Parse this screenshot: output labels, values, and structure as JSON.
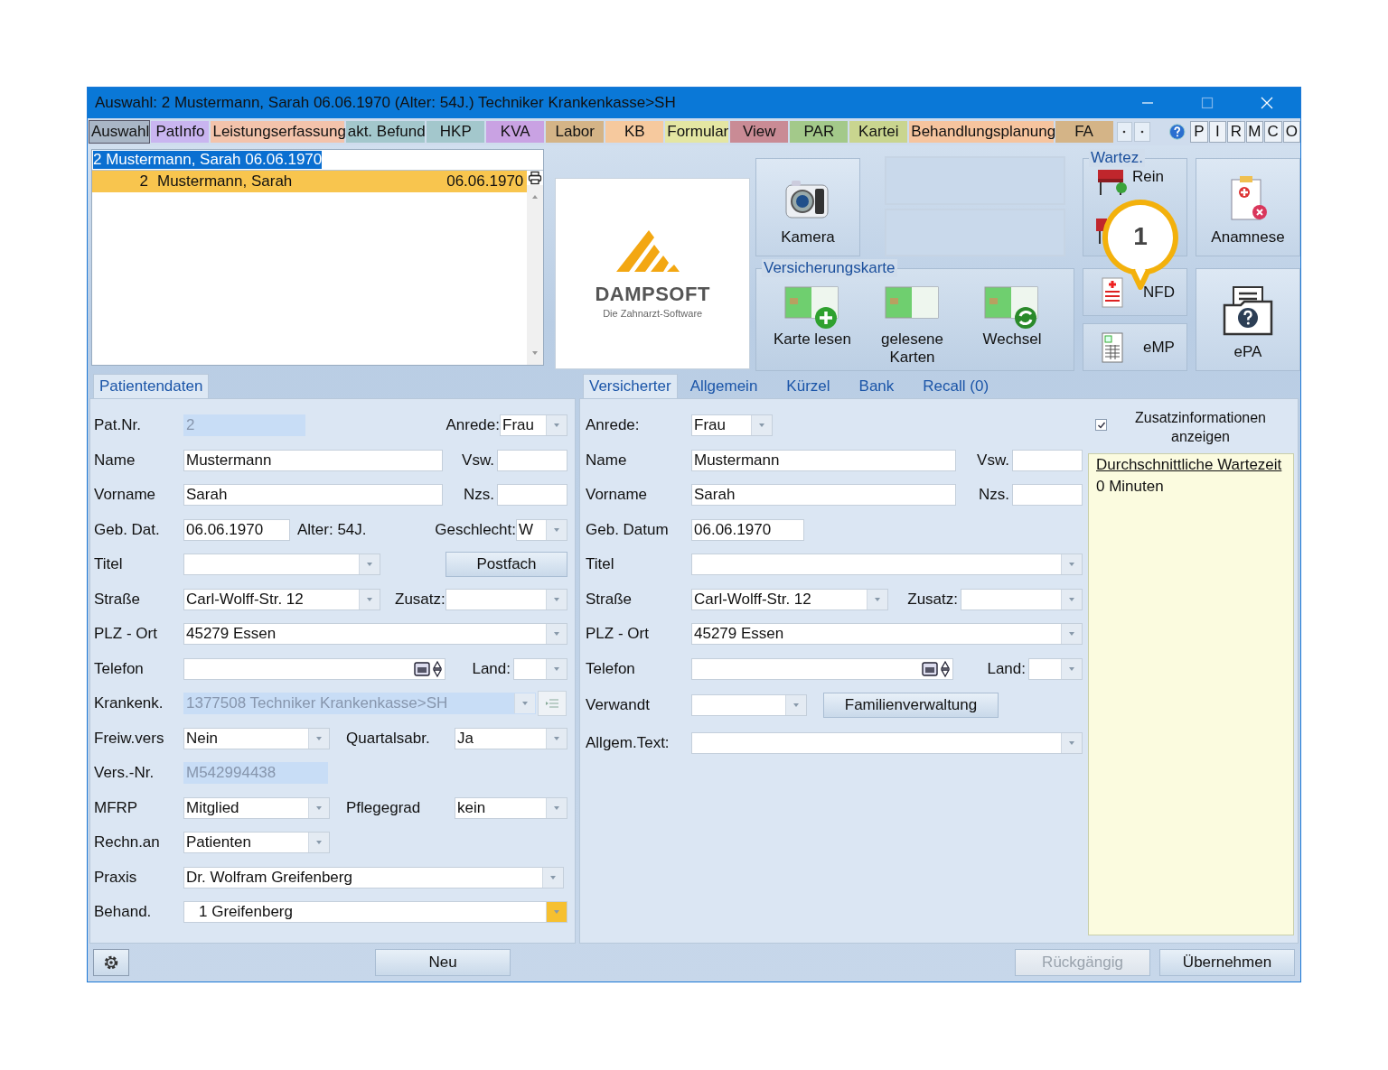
{
  "window": {
    "title": "Auswahl: 2  Mustermann, Sarah  06.06.1970 (Alter: 54J.)  Techniker Krankenkasse>SH"
  },
  "tabs": [
    {
      "label": "Auswahl",
      "color": "#a9b6c6",
      "selected": true
    },
    {
      "label": "PatInfo",
      "color": "#c9b5f0",
      "selected": false
    },
    {
      "label": "Leistungserfassung",
      "color": "#f3c3ab",
      "selected": false
    },
    {
      "label": "akt. Befund",
      "color": "#a3c7cc",
      "selected": false
    },
    {
      "label": "HKP",
      "color": "#a3c7cc",
      "selected": false
    },
    {
      "label": "KVA",
      "color": "#c9a2e3",
      "selected": false
    },
    {
      "label": "Labor",
      "color": "#d4b487",
      "selected": false
    },
    {
      "label": "KB",
      "color": "#f6c99e",
      "selected": false
    },
    {
      "label": "Formular",
      "color": "#e4e6a3",
      "selected": false
    },
    {
      "label": "View",
      "color": "#c98b95",
      "selected": false
    },
    {
      "label": "PAR",
      "color": "#a3c98a",
      "selected": false
    },
    {
      "label": "Kartei",
      "color": "#c9d58f",
      "selected": false
    },
    {
      "label": "Behandlungsplanung",
      "color": "#f6c49e",
      "selected": false
    },
    {
      "label": "FA",
      "color": "#d4b487",
      "selected": false
    }
  ],
  "quick_buttons": [
    "P",
    "I",
    "R",
    "M",
    "C",
    "O"
  ],
  "patient_search": {
    "value": "2 Mustermann, Sarah  06.06.1970"
  },
  "patient_list": [
    {
      "number": "2",
      "name": "Mustermann, Sarah",
      "birthdate": "06.06.1970",
      "selected": true
    }
  ],
  "logo": {
    "name": "DAMPSOFT",
    "tagline": "Die Zahnarzt-Software"
  },
  "toolbar": {
    "camera": "Kamera",
    "waiting_room_title": "Wartez.",
    "waiting_in": "Rein",
    "anamnesis": "Anamnese",
    "nfd": "NFD",
    "emp": "eMP",
    "epa": "ePA"
  },
  "insurance_card": {
    "title": "Versicherungskarte",
    "buttons": [
      {
        "label": "Karte lesen",
        "kind": "add"
      },
      {
        "label": "gelesene Karten",
        "kind": "plain"
      },
      {
        "label": "Wechsel",
        "kind": "swap"
      }
    ]
  },
  "callout": {
    "text": "1"
  },
  "patient_data": {
    "tab": "Patientendaten",
    "pat_nr": {
      "label": "Pat.Nr.",
      "value": "2",
      "disabled": true
    },
    "anrede": {
      "label": "Anrede:",
      "value": "Frau"
    },
    "name": {
      "label": "Name",
      "value": "Mustermann"
    },
    "vsw": {
      "label": "Vsw."
    },
    "vorname": {
      "label": "Vorname",
      "value": "Sarah"
    },
    "nzs": {
      "label": "Nzs."
    },
    "geb": {
      "label": "Geb. Dat.",
      "value": "06.06.1970"
    },
    "alter": "Alter: 54J.",
    "geschlecht": {
      "label": "Geschlecht:",
      "value": "W"
    },
    "titel": {
      "label": "Titel"
    },
    "postfach": "Postfach",
    "strasse": {
      "label": "Straße",
      "value": "Carl-Wolff-Str. 12"
    },
    "zusatz": {
      "label": "Zusatz:"
    },
    "plz_ort": {
      "label": "PLZ - Ort",
      "value": "45279 Essen"
    },
    "telefon": {
      "label": "Telefon"
    },
    "land": {
      "label": "Land:"
    },
    "krankenk": {
      "label": "Krankenk.",
      "value": "1377508 Techniker Krankenkasse>SH",
      "disabled": true
    },
    "freiw": {
      "label": "Freiw.vers",
      "value": "Nein"
    },
    "quartal": {
      "label": "Quartalsabr.",
      "value": "Ja"
    },
    "vers_nr": {
      "label": "Vers.-Nr.",
      "value": "M542994438",
      "disabled": true
    },
    "mfrp": {
      "label": "MFRP",
      "value": "Mitglied"
    },
    "pflegegrad": {
      "label": "Pflegegrad",
      "value": "kein"
    },
    "rechn": {
      "label": "Rechn.an",
      "value": "Patienten"
    },
    "praxis": {
      "label": "Praxis",
      "value": "Dr. Wolfram Greifenberg"
    },
    "behand": {
      "label": "Behand.",
      "value": "1 Greifenberg"
    }
  },
  "insured": {
    "tabs": [
      {
        "label": "Versicherter",
        "selected": true
      },
      {
        "label": "Allgemein",
        "selected": false
      },
      {
        "label": "Kürzel",
        "selected": false
      },
      {
        "label": "Bank",
        "selected": false
      },
      {
        "label": "Recall (0)",
        "selected": false
      }
    ],
    "anrede": {
      "label": "Anrede:",
      "value": "Frau"
    },
    "name": {
      "label": "Name",
      "value": "Mustermann"
    },
    "vsw": {
      "label": "Vsw."
    },
    "vorname": {
      "label": "Vorname",
      "value": "Sarah"
    },
    "nzs": {
      "label": "Nzs."
    },
    "geb": {
      "label": "Geb. Datum",
      "value": "06.06.1970"
    },
    "titel": {
      "label": "Titel"
    },
    "strasse": {
      "label": "Straße",
      "value": "Carl-Wolff-Str. 12"
    },
    "zusatz": {
      "label": "Zusatz:"
    },
    "plz_ort": {
      "label": "PLZ - Ort",
      "value": "45279 Essen"
    },
    "telefon": {
      "label": "Telefon"
    },
    "land": {
      "label": "Land:"
    },
    "verwandt": {
      "label": "Verwandt"
    },
    "familien": "Familienverwaltung",
    "allgem": {
      "label": "Allgem.Text:"
    }
  },
  "extra_info": {
    "label": "Zusatzinformationen anzeigen",
    "checked": true,
    "title": "Durchschnittliche Wartezeit",
    "value": "0 Minuten"
  },
  "footer": {
    "new": {
      "label": "Neu",
      "disabled": false
    },
    "undo": {
      "label": "Rückgängig",
      "disabled": true
    },
    "apply": {
      "label": "Übernehmen",
      "disabled": false
    }
  }
}
